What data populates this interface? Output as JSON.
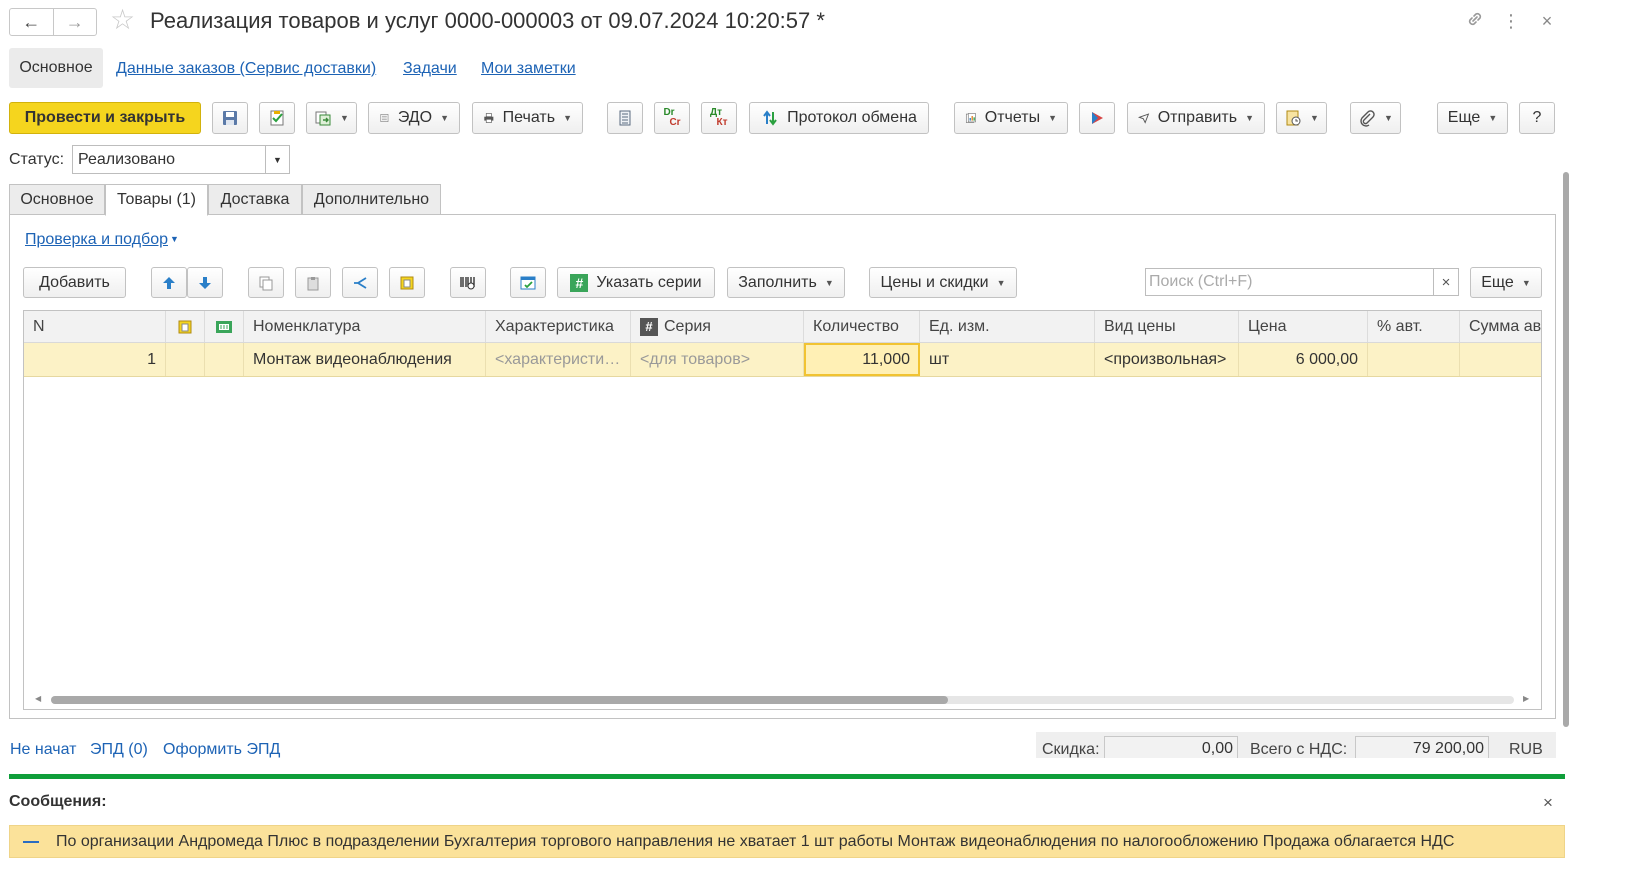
{
  "window": {
    "title": "Реализация товаров и услуг 0000-000003 от 09.07.2024 10:20:57 *",
    "back_icon": "←",
    "forward_icon": "→",
    "link_icon": "🔗",
    "more_icon": "⋮",
    "close_icon": "×"
  },
  "top_tabs": {
    "active": "Основное",
    "links": [
      "Данные заказов (Сервис доставки)",
      "Задачи",
      "Мои заметки"
    ]
  },
  "toolbar": {
    "post_close": "Провести и закрыть",
    "edo": "ЭДО",
    "print": "Печать",
    "dr_label": "Dr",
    "cr_label": "Cr",
    "dt_label": "Дт",
    "kt_label": "Кт",
    "exchange_protocol": "Протокол обмена",
    "reports": "Отчеты",
    "send": "Отправить",
    "more": "Еще",
    "help": "?"
  },
  "status": {
    "label": "Статус:",
    "value": "Реализовано"
  },
  "inner_tabs": [
    "Основное",
    "Товары (1)",
    "Доставка",
    "Дополнительно"
  ],
  "goods_panel": {
    "check_link": "Проверка и подбор",
    "add": "Добавить",
    "specify_series": "Указать серии",
    "fill": "Заполнить",
    "prices_discounts": "Цены и скидки",
    "search_placeholder": "Поиск (Ctrl+F)",
    "search_clear": "×",
    "more": "Еще"
  },
  "table": {
    "columns": [
      "N",
      "",
      "",
      "Номенклатура",
      "Характеристика",
      "Серия",
      "Количество",
      "Ед. изм.",
      "Вид цены",
      "Цена",
      "% авт.",
      "Сумма ав"
    ],
    "rows": [
      {
        "n": "1",
        "item": "Монтаж видеонаблюдения",
        "characteristic": "<характеристи…",
        "series": "<для товаров>",
        "quantity": "11,000",
        "unit": "шт",
        "price_type": "<произвольная>",
        "price": "6 000,00",
        "auto_pct": "",
        "auto_sum": ""
      }
    ]
  },
  "footer": {
    "not_started": "Не начат",
    "epd": "ЭПД (0)",
    "make_epd": "Оформить ЭПД",
    "discount_label": "Скидка:",
    "discount_value": "0,00",
    "total_label": "Всего с НДС:",
    "total_value": "79 200,00",
    "currency": "RUB"
  },
  "messages": {
    "title": "Сообщения:",
    "close": "×",
    "items": [
      "По организации Андромеда Плюс в подразделении Бухгалтерия торгового направления не хватает 1 шт работы Монтаж видеонаблюдения по налогообложению Продажа облагается НДС"
    ]
  }
}
